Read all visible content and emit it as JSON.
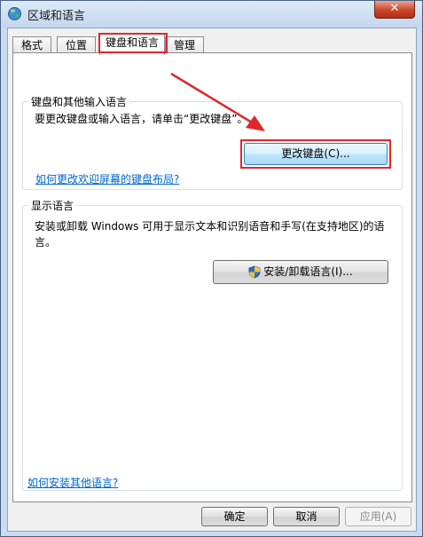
{
  "window": {
    "title": "区域和语言",
    "close_label": "✕"
  },
  "tabs": [
    {
      "label": "格式"
    },
    {
      "label": "位置"
    },
    {
      "label": "键盘和语言",
      "active": true
    },
    {
      "label": "管理"
    }
  ],
  "keyboard_group": {
    "label": "键盘和其他输入语言",
    "description": "要更改键盘或输入语言，请单击“更改键盘”。",
    "change_button": "更改键盘(C)...",
    "welcome_link": "如何更改欢迎屏幕的键盘布局?"
  },
  "display_group": {
    "label": "显示语言",
    "description_line1": "安装或卸载 Windows 可用于显示文本和识别语音和手写(在支持地区)的语",
    "description_line2": "言。",
    "install_button": "安装/卸载语言(I)..."
  },
  "footer": {
    "install_link": "如何安装其他语言?",
    "ok": "确定",
    "cancel": "取消",
    "apply": "应用(A)"
  },
  "colors": {
    "highlight": "#e0272c",
    "link": "#0066cc"
  }
}
